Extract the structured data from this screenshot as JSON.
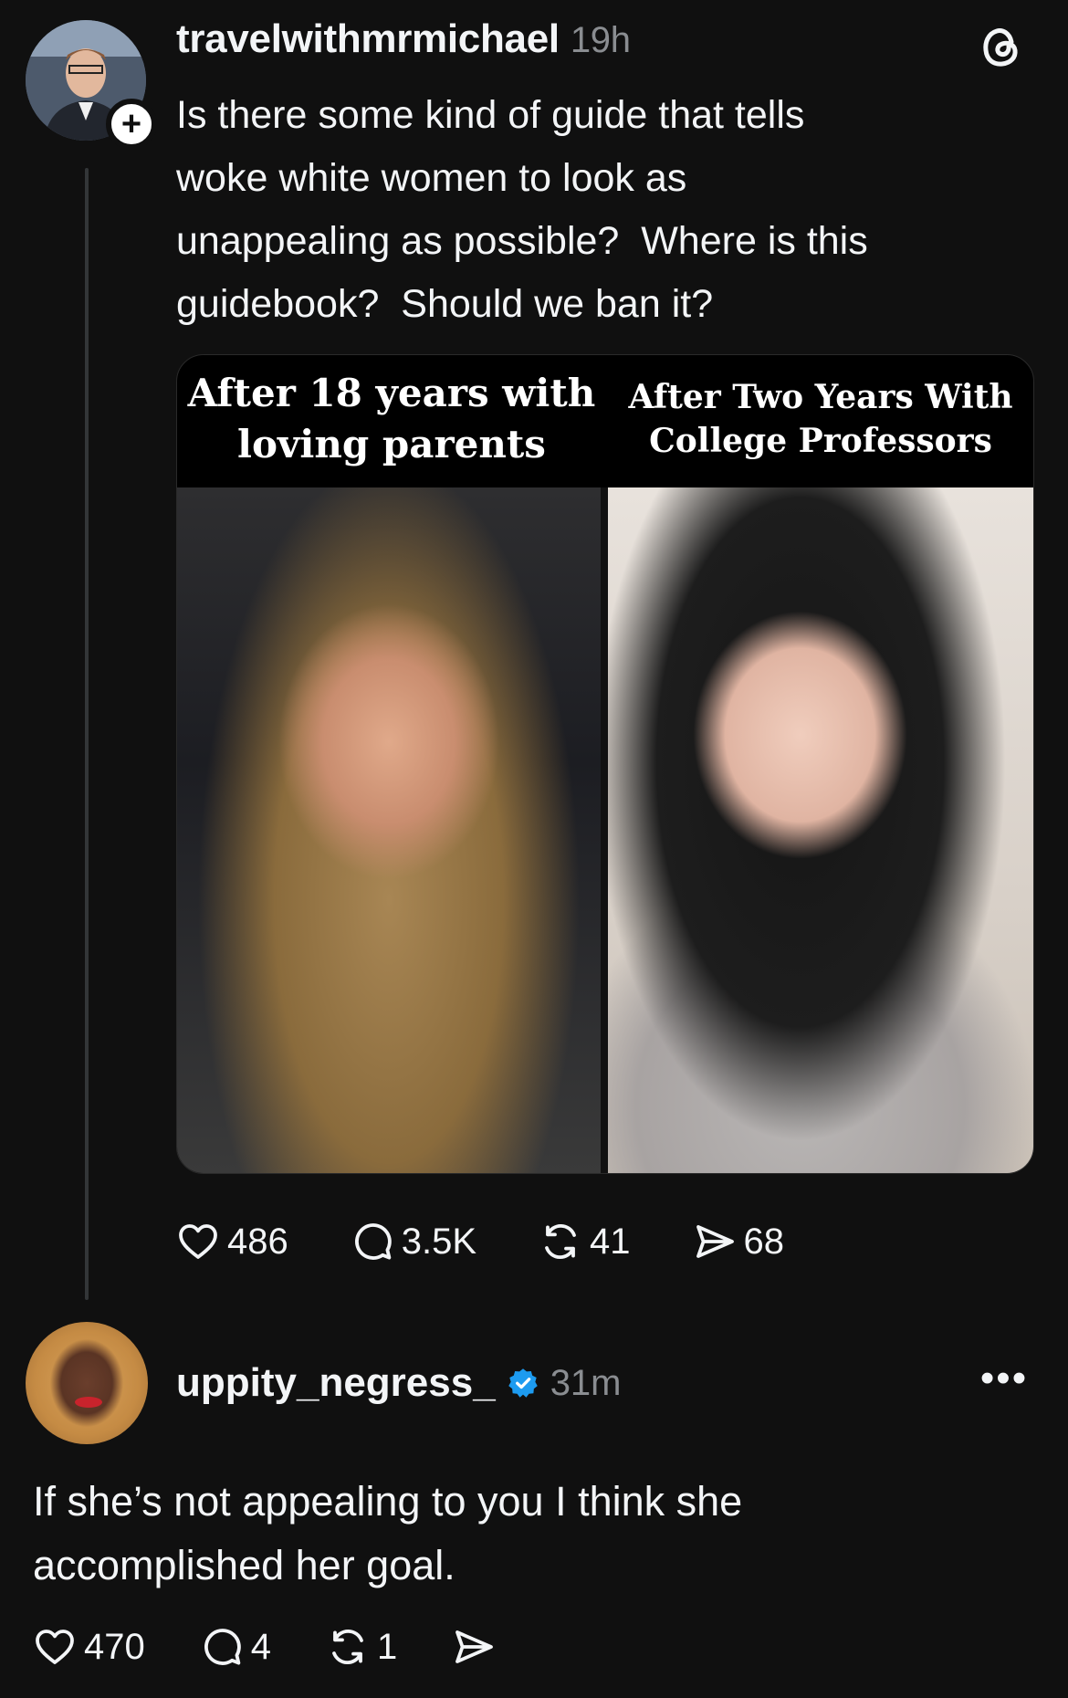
{
  "post": {
    "username": "travelwithmrmichael",
    "time": "19h",
    "text": "Is there some kind of guide that tells\nwoke white women to look as\nunappealing as possible?  Where is this\nguidebook?  Should we ban it?",
    "image": {
      "left_caption": "After 18 years with\nloving parents",
      "right_caption": "After Two Years With\nCollege Professors"
    },
    "actions": {
      "likes": "486",
      "comments": "3.5K",
      "reposts": "41",
      "shares": "68"
    },
    "icons": [
      "heart-icon",
      "comment-icon",
      "repost-icon",
      "share-icon",
      "threads-logo-icon",
      "follow-plus-icon"
    ]
  },
  "reply": {
    "username": "uppity_negress_",
    "time": "31m",
    "text": "If she’s not appealing to you I think she\naccomplished her goal.",
    "actions": {
      "likes": "470",
      "comments": "4",
      "reposts": "1"
    },
    "verified_color": "#1d9bf0"
  },
  "colors": {
    "background": "#101010",
    "text": "#f3f5f7",
    "muted": "#8a8d91",
    "thread_line": "#333638"
  }
}
